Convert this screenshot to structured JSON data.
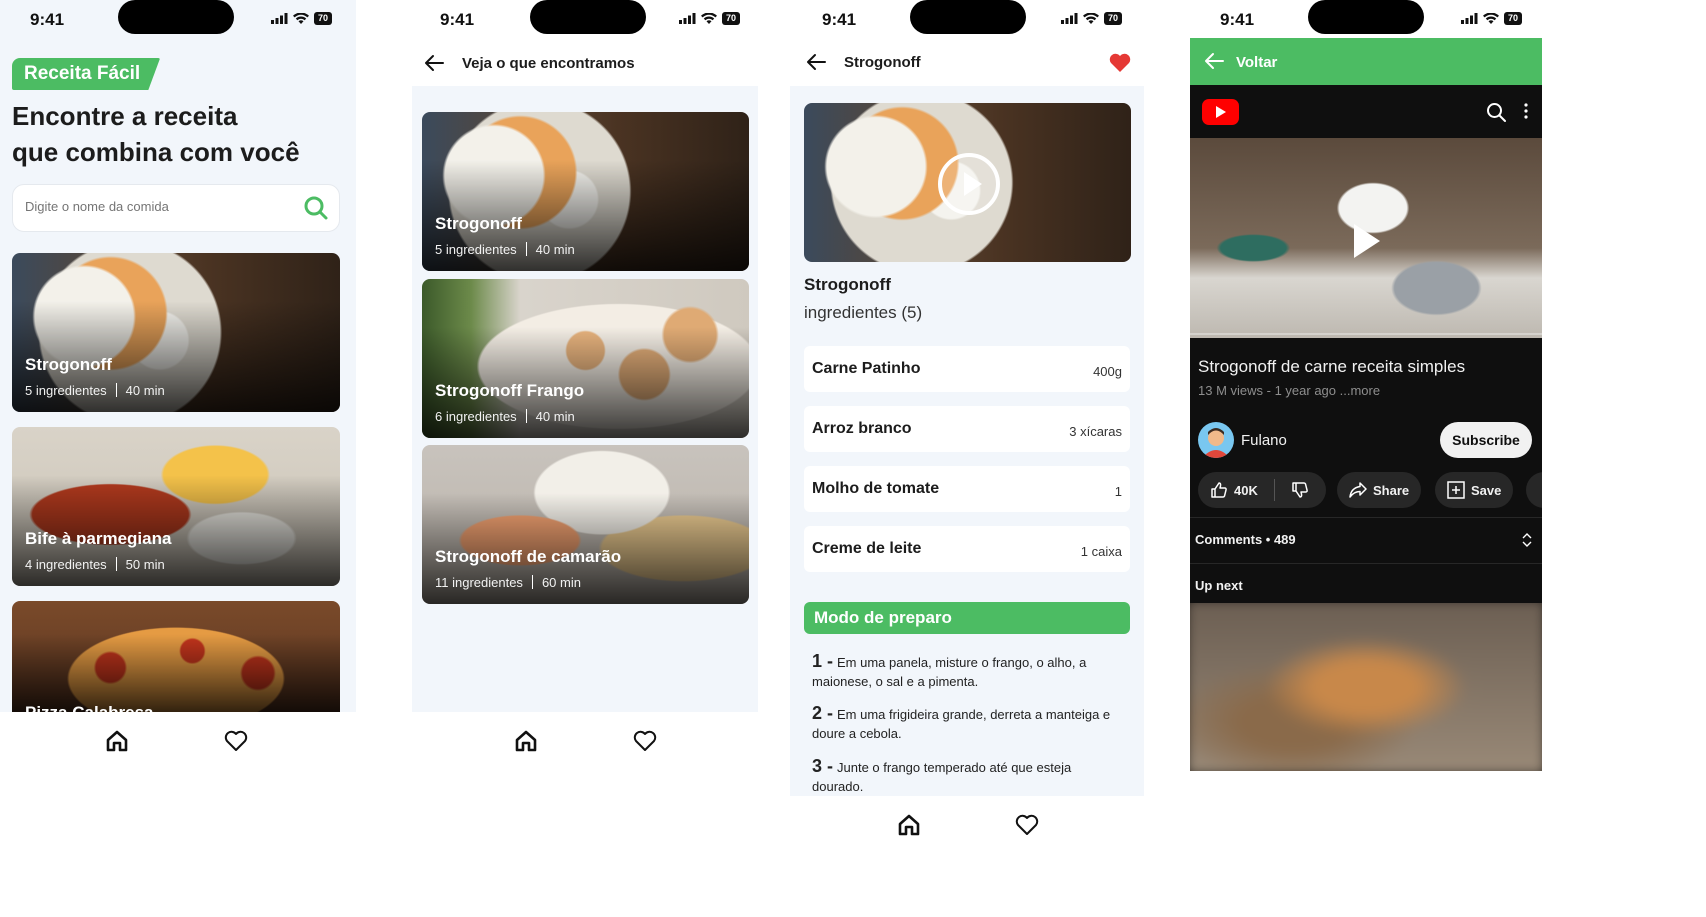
{
  "status_bar": {
    "time": "9:41",
    "battery": "70"
  },
  "screen1": {
    "brand": "Receita Fácil",
    "headline_line1": "Encontre a receita",
    "headline_line2": "que combina com você",
    "search": {
      "placeholder": "Digite o nome da comida"
    },
    "recipes": [
      {
        "title": "Strogonoff",
        "ingredients": "5 ingredientes",
        "time": "40 min"
      },
      {
        "title": "Bife à parmegiana",
        "ingredients": "4 ingredientes",
        "time": "50 min"
      },
      {
        "title": "Pizza Calabresa"
      }
    ]
  },
  "screen2": {
    "title": "Veja o que encontramos",
    "results": [
      {
        "title": "Strogonoff",
        "ingredients": "5 ingredientes",
        "time": "40 min"
      },
      {
        "title": "Strogonoff Frango",
        "ingredients": "6 ingredientes",
        "time": "40 min"
      },
      {
        "title": "Strogonoff de camarão",
        "ingredients": "11 ingredientes",
        "time": "60 min"
      }
    ]
  },
  "screen3": {
    "title": "Strogonoff",
    "recipe_name": "Strogonoff",
    "ingredients_label": "ingredientes (5)",
    "ingredients": [
      {
        "name": "Carne Patinho",
        "qty": "400g"
      },
      {
        "name": "Arroz branco",
        "qty": "3 xícaras"
      },
      {
        "name": "Molho de tomate",
        "qty": "1"
      },
      {
        "name": "Creme de leite",
        "qty": "1 caixa"
      }
    ],
    "preparo_label": "Modo de preparo",
    "steps": [
      {
        "num": "1 -",
        "text": "Em uma panela, misture o frango, o alho, a maionese, o sal e a pimenta."
      },
      {
        "num": "2 -",
        "text": "Em uma frigideira grande, derreta a manteiga e doure a cebola."
      },
      {
        "num": "3 -",
        "text": "Junte o frango temperado até que esteja dourado."
      }
    ]
  },
  "screen4": {
    "back_label": "Voltar",
    "video_title": "Strogonoff de carne receita simples",
    "video_meta": "13 M views - 1 year ago ...more",
    "channel": "Fulano",
    "subscribe": "Subscribe",
    "likes": "40K",
    "share": "Share",
    "save": "Save",
    "comments": "Comments • 489",
    "up_next": "Up next"
  },
  "colors": {
    "accent_green": "#4cbc63",
    "heart_red": "#e53935",
    "youtube_red": "#ff0000",
    "dark_bg": "#0f0f0f"
  }
}
